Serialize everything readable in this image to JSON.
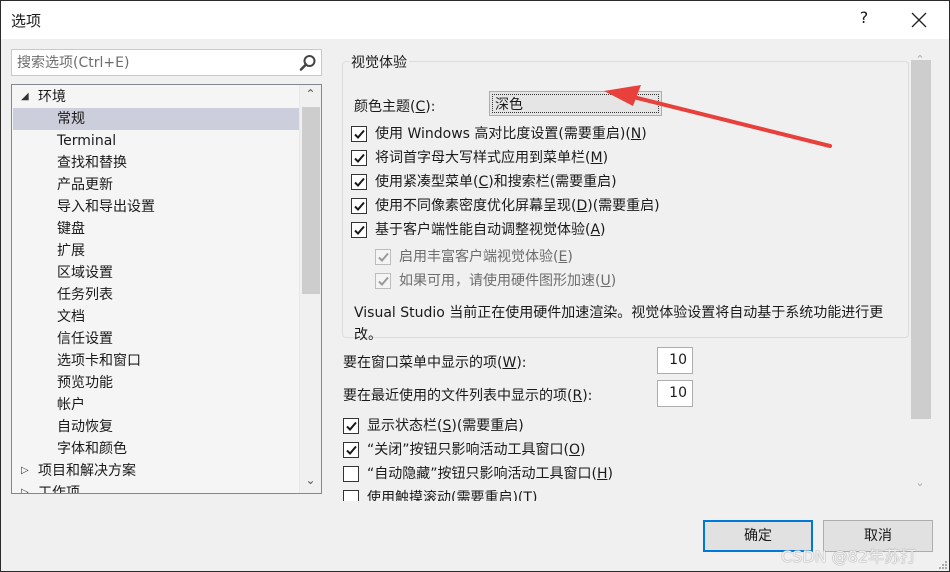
{
  "window": {
    "title": "选项",
    "help_label": "?",
    "close_icon": "close-icon"
  },
  "search": {
    "placeholder": "搜索选项(Ctrl+E)",
    "value": "",
    "icon": "search-icon"
  },
  "tree": {
    "items": [
      {
        "label": "环境",
        "level": 0,
        "expander": "expanded",
        "selected": false
      },
      {
        "label": "常规",
        "level": 1,
        "selected": true
      },
      {
        "label": "Terminal",
        "level": 1,
        "selected": false
      },
      {
        "label": "查找和替换",
        "level": 1,
        "selected": false
      },
      {
        "label": "产品更新",
        "level": 1,
        "selected": false
      },
      {
        "label": "导入和导出设置",
        "level": 1,
        "selected": false
      },
      {
        "label": "键盘",
        "level": 1,
        "selected": false
      },
      {
        "label": "扩展",
        "level": 1,
        "selected": false
      },
      {
        "label": "区域设置",
        "level": 1,
        "selected": false
      },
      {
        "label": "任务列表",
        "level": 1,
        "selected": false
      },
      {
        "label": "文档",
        "level": 1,
        "selected": false
      },
      {
        "label": "信任设置",
        "level": 1,
        "selected": false
      },
      {
        "label": "选项卡和窗口",
        "level": 1,
        "selected": false
      },
      {
        "label": "预览功能",
        "level": 1,
        "selected": false
      },
      {
        "label": "帐户",
        "level": 1,
        "selected": false
      },
      {
        "label": "自动恢复",
        "level": 1,
        "selected": false
      },
      {
        "label": "字体和颜色",
        "level": 1,
        "selected": false
      },
      {
        "label": "项目和解决方案",
        "level": 0,
        "expander": "collapsed",
        "selected": false
      },
      {
        "label": "工作项",
        "level": 0,
        "expander": "collapsed",
        "selected": false
      }
    ]
  },
  "visual_experience": {
    "group_title": "视觉体验",
    "color_theme_label": "颜色主题(",
    "color_theme_key": "C",
    "color_theme_suffix": "):",
    "color_theme_value": "深色",
    "checkboxes": [
      {
        "pre": "使用 Windows 高对比度设置(需要重启)(",
        "key": "N",
        "post": ")",
        "checked": true,
        "enabled": true
      },
      {
        "pre": "将词首字母大写样式应用到菜单栏(",
        "key": "M",
        "post": ")",
        "checked": true,
        "enabled": true
      },
      {
        "pre": "使用紧凑型菜单(",
        "key": "C",
        "post": ")和搜索栏(需要重启)",
        "checked": true,
        "enabled": true
      },
      {
        "pre": "使用不同像素密度优化屏幕呈现(",
        "key": "D",
        "post": ")(需要重启)",
        "checked": true,
        "enabled": true
      },
      {
        "pre": "基于客户端性能自动调整视觉体验(",
        "key": "A",
        "post": ")",
        "checked": true,
        "enabled": true
      }
    ],
    "sub_checkboxes": [
      {
        "pre": "启用丰富客户端视觉体验(",
        "key": "E",
        "post": ")",
        "checked": true,
        "enabled": false
      },
      {
        "pre": "如果可用，请使用硬件图形加速(",
        "key": "U",
        "post": ")",
        "checked": true,
        "enabled": false
      }
    ],
    "note": "Visual Studio 当前正在使用硬件加速渲染。视觉体验设置将自动基于系统功能进行更改。"
  },
  "window_menu_items": {
    "pre": "要在窗口菜单中显示的项(",
    "key": "W",
    "post": "):",
    "value": "10"
  },
  "recent_files_items": {
    "pre": "要在最近使用的文件列表中显示的项(",
    "key": "R",
    "post": "):",
    "value": "10"
  },
  "bottom_checkboxes": [
    {
      "pre": "显示状态栏(",
      "key": "S",
      "post": ")(需要重启)",
      "checked": true
    },
    {
      "pre": "“关闭”按钮只影响活动工具窗口(",
      "key": "O",
      "post": ")",
      "checked": true
    },
    {
      "pre": "“自动隐藏”按钮只影响活动工具窗口(",
      "key": "H",
      "post": ")",
      "checked": false
    },
    {
      "pre": "使用触摸滚动(需要重启)(",
      "key": "T",
      "post": ")",
      "checked": false
    }
  ],
  "buttons": {
    "ok": "确定",
    "cancel": "取消"
  },
  "watermark": "CSDN @82年苏打",
  "colors": {
    "accent": "#0078d7",
    "selection": "#cccedb",
    "annotation_arrow": "#e8403a"
  }
}
